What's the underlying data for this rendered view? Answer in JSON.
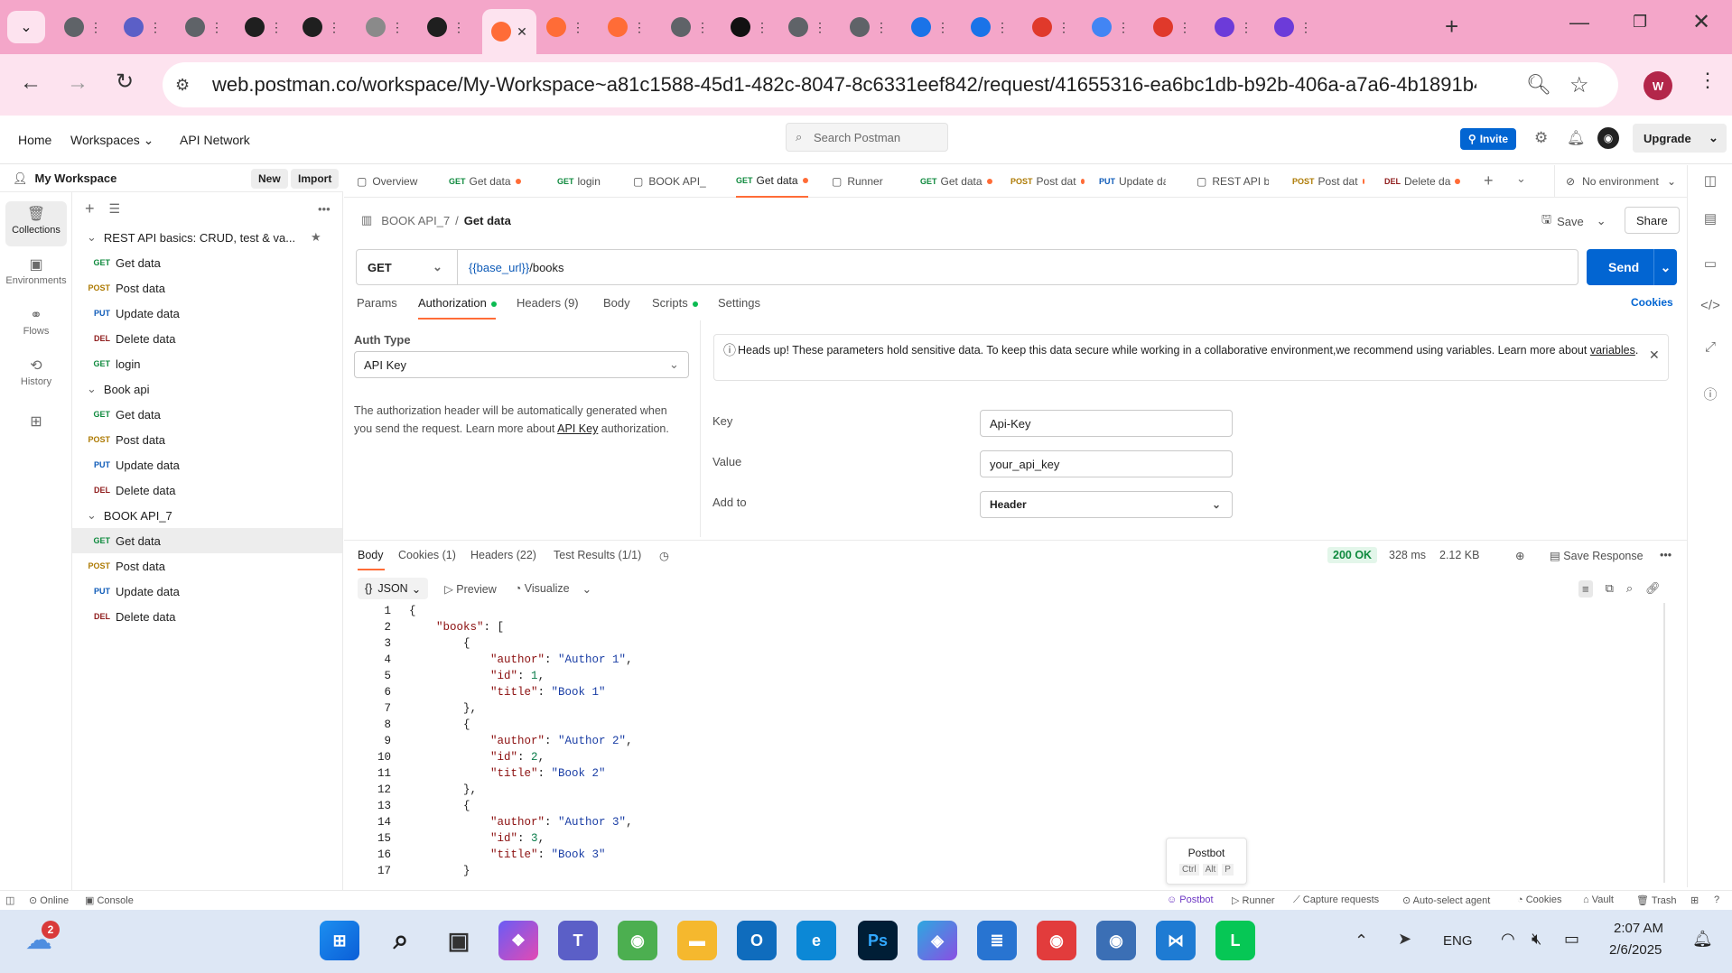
{
  "browser": {
    "tabs": [
      {
        "icon": "chrome-icon",
        "color": "#5f6368"
      },
      {
        "icon": "teams-icon",
        "color": "#5b5fc7"
      },
      {
        "icon": "globe-icon",
        "color": "#5f6368"
      },
      {
        "icon": "github-icon",
        "color": "#1f1f1f"
      },
      {
        "icon": "github-icon",
        "color": "#1f1f1f"
      },
      {
        "icon": "globe-icon",
        "color": "#8a8a8a"
      },
      {
        "icon": "github-icon",
        "color": "#1f1f1f"
      },
      {
        "icon": "postman-icon",
        "color": "#ff6c37"
      },
      {
        "icon": "postman-icon",
        "color": "#ff6c37"
      },
      {
        "icon": "postman-icon",
        "color": "#ff6c37"
      },
      {
        "icon": "chrome-icon",
        "color": "#5f6368"
      },
      {
        "icon": "openai-icon",
        "color": "#111111"
      },
      {
        "icon": "globe-icon",
        "color": "#5f6368"
      },
      {
        "icon": "globe-icon",
        "color": "#5f6368"
      },
      {
        "icon": "g-icon",
        "color": "#1a73e8"
      },
      {
        "icon": "g-icon",
        "color": "#1a73e8"
      },
      {
        "icon": "oracle-icon",
        "color": "#e0392b"
      },
      {
        "icon": "google-icon",
        "color": "#4285f4"
      },
      {
        "icon": "oracle-icon",
        "color": "#e0392b"
      },
      {
        "icon": "paypal-icon",
        "color": "#6c3bd9"
      },
      {
        "icon": "paypal-icon",
        "color": "#6c3bd9"
      }
    ],
    "url": "web.postman.co/workspace/My-Workspace~a81c1588-45d1-482c-8047-8c6331eef842/request/41655316-ea6bc1db-b92b-406a-a7a6-4b1891b476ba?ta...",
    "profile_initial": "W"
  },
  "header": {
    "nav": [
      "Home",
      "Workspaces",
      "API Network"
    ],
    "search_placeholder": "Search Postman",
    "invite": "Invite",
    "upgrade": "Upgrade"
  },
  "workspace": {
    "name": "My Workspace",
    "new": "New",
    "import": "Import"
  },
  "rail": [
    "Collections",
    "Environments",
    "Flows",
    "History"
  ],
  "collections": [
    {
      "name": "REST API basics: CRUD, test & va...",
      "items": [
        {
          "m": "GET",
          "l": "Get data"
        },
        {
          "m": "POST",
          "l": "Post data"
        },
        {
          "m": "PUT",
          "l": "Update data"
        },
        {
          "m": "DEL",
          "l": "Delete data"
        },
        {
          "m": "GET",
          "l": "login"
        }
      ]
    },
    {
      "name": "Book api",
      "items": [
        {
          "m": "GET",
          "l": "Get data"
        },
        {
          "m": "POST",
          "l": "Post data"
        },
        {
          "m": "PUT",
          "l": "Update data"
        },
        {
          "m": "DEL",
          "l": "Delete data"
        }
      ]
    },
    {
      "name": "BOOK API_7",
      "items": [
        {
          "m": "GET",
          "l": "Get data"
        },
        {
          "m": "POST",
          "l": "Post data"
        },
        {
          "m": "PUT",
          "l": "Update data"
        },
        {
          "m": "DEL",
          "l": "Delete data"
        }
      ]
    }
  ],
  "request_tabs": [
    {
      "m": "",
      "l": "Overview"
    },
    {
      "m": "GET",
      "l": "Get data"
    },
    {
      "m": "GET",
      "l": "login"
    },
    {
      "m": "",
      "l": "BOOK API_"
    },
    {
      "m": "GET",
      "l": "Get data"
    },
    {
      "m": "",
      "l": "Runner"
    },
    {
      "m": "GET",
      "l": "Get data"
    },
    {
      "m": "POST",
      "l": "Post dat"
    },
    {
      "m": "PUT",
      "l": "Update da"
    },
    {
      "m": "",
      "l": "REST API b"
    },
    {
      "m": "POST",
      "l": "Post dat"
    },
    {
      "m": "DEL",
      "l": "Delete da"
    }
  ],
  "environment": "No environment",
  "breadcrumb": {
    "collection": "BOOK API_7",
    "sep": "/",
    "request": "Get data"
  },
  "save": "Save",
  "share": "Share",
  "method": "GET",
  "url_var": "{{base_url}}",
  "url_path": " /books",
  "send": "Send",
  "req_tabs": [
    "Params",
    "Authorization",
    "Headers (9)",
    "Body",
    "Scripts",
    "Settings"
  ],
  "cookies": "Cookies",
  "auth": {
    "type_label": "Auth Type",
    "type": "API Key",
    "help_1": "The authorization header will be automatically generated when you send the request. Learn more about ",
    "help_link": "API Key",
    "help_2": " authorization.",
    "warning_1": "Heads up! These parameters hold sensitive data. To keep this data secure while working in a collaborative environment,we recommend using variables. Learn more about ",
    "warning_link": "variables",
    "warning_2": ".",
    "key_label": "Key",
    "key": "Api-Key",
    "value_label": "Value",
    "value": "your_api_key",
    "addto_label": "Add to",
    "addto": "Header"
  },
  "response": {
    "tabs": [
      "Body",
      "Cookies (1)",
      "Headers (22)",
      "Test Results (1/1)"
    ],
    "status": "200 OK",
    "time": "328 ms",
    "size": "2.12 KB",
    "save_response": "Save Response",
    "format": "JSON",
    "preview": "Preview",
    "visualize": "Visualize",
    "lines": [
      {
        "n": "1",
        "t": "{"
      },
      {
        "n": "2",
        "t": "    \"books\": ["
      },
      {
        "n": "3",
        "t": "        {"
      },
      {
        "n": "4",
        "t": "            \"author\": \"Author 1\","
      },
      {
        "n": "5",
        "t": "            \"id\": 1,"
      },
      {
        "n": "6",
        "t": "            \"title\": \"Book 1\""
      },
      {
        "n": "7",
        "t": "        },"
      },
      {
        "n": "8",
        "t": "        {"
      },
      {
        "n": "9",
        "t": "            \"author\": \"Author 2\","
      },
      {
        "n": "10",
        "t": "            \"id\": 2,"
      },
      {
        "n": "11",
        "t": "            \"title\": \"Book 2\""
      },
      {
        "n": "12",
        "t": "        },"
      },
      {
        "n": "13",
        "t": "        {"
      },
      {
        "n": "14",
        "t": "            \"author\": \"Author 3\","
      },
      {
        "n": "15",
        "t": "            \"id\": 3,"
      },
      {
        "n": "16",
        "t": "            \"title\": \"Book 3\""
      },
      {
        "n": "17",
        "t": "        }"
      }
    ]
  },
  "postbot_tip": {
    "title": "Postbot",
    "keys": [
      "Ctrl",
      "Alt",
      "P"
    ]
  },
  "statusbar": {
    "left": [
      "Online",
      "Console"
    ],
    "right": [
      "Postbot",
      "Runner",
      "Capture requests",
      "Auto-select agent",
      "Cookies",
      "Vault",
      "Trash"
    ]
  },
  "taskbar": {
    "weather_badge": "2",
    "lang": "ENG",
    "time": "2:07 AM",
    "date": "2/6/2025"
  }
}
